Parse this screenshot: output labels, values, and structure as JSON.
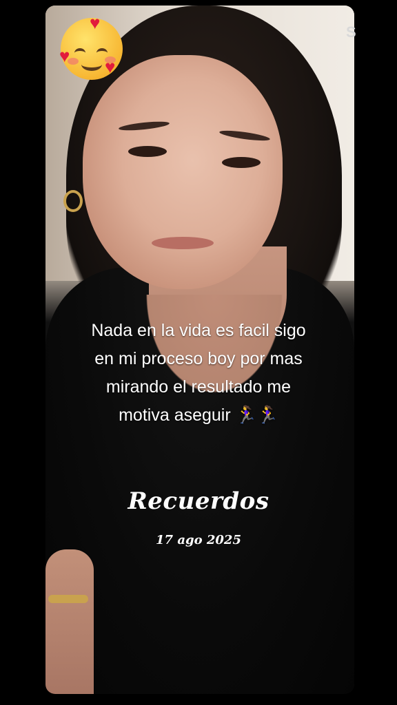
{
  "overlay": {
    "caption_line1": "Nada en la vida es facil sigo",
    "caption_line2": "en mi proceso boy por mas",
    "caption_line3": "mirando el resultado me",
    "caption_line4": "motiva aseguir 🏃‍♀️🏃‍♀️",
    "album_title": "Recuerdos",
    "album_date": "17 ago 2025"
  },
  "sticker": {
    "icon": "smiling-face-with-hearts-icon"
  },
  "colors": {
    "background": "#000000",
    "text": "#ffffff"
  }
}
